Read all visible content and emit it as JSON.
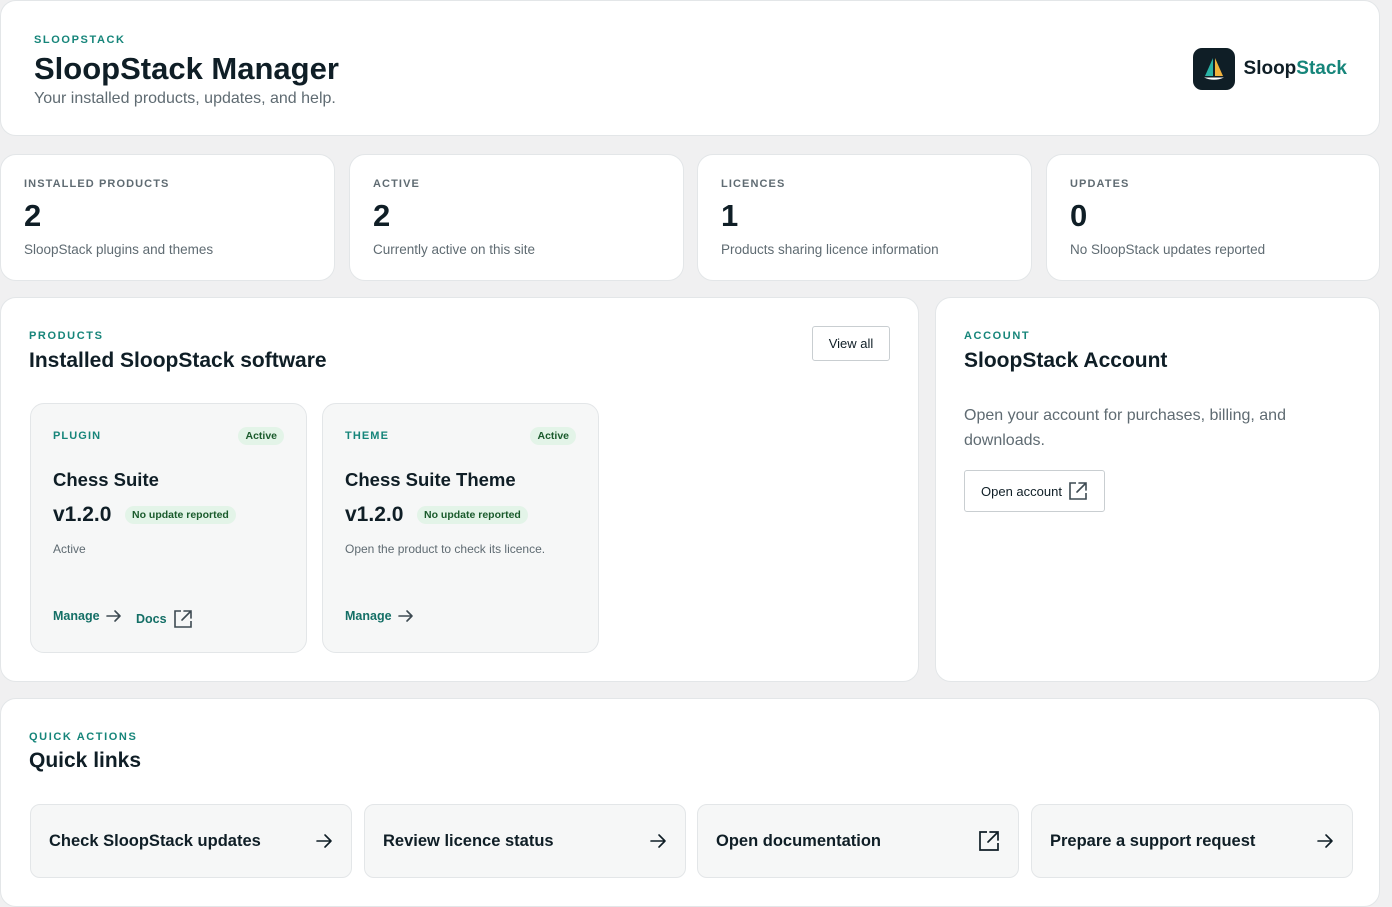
{
  "header": {
    "eyebrow": "SLOOPSTACK",
    "title": "SloopStack Manager",
    "subtitle": "Your installed products, updates, and help.",
    "brand_primary": "Sloop",
    "brand_accent": "Stack",
    "logo_icon": "sailboat-icon"
  },
  "stats": [
    {
      "label": "INSTALLED PRODUCTS",
      "value": "2",
      "description": "SloopStack plugins and themes"
    },
    {
      "label": "ACTIVE",
      "value": "2",
      "description": "Currently active on this site"
    },
    {
      "label": "LICENCES",
      "value": "1",
      "description": "Products sharing licence information"
    },
    {
      "label": "UPDATES",
      "value": "0",
      "description": "No SloopStack updates reported"
    }
  ],
  "products_section": {
    "eyebrow": "PRODUCTS",
    "title": "Installed SloopStack software",
    "view_all_label": "View all",
    "items": [
      {
        "type": "PLUGIN",
        "status": "Active",
        "name": "Chess Suite",
        "version": "v1.2.0",
        "update_status": "No update reported",
        "note": "Active",
        "manage_label": "Manage",
        "docs_label": "Docs"
      },
      {
        "type": "THEME",
        "status": "Active",
        "name": "Chess Suite Theme",
        "version": "v1.2.0",
        "update_status": "No update reported",
        "note": "Open the product to check its licence.",
        "manage_label": "Manage"
      }
    ]
  },
  "account": {
    "eyebrow": "ACCOUNT",
    "title": "SloopStack Account",
    "description": "Open your account for purchases, billing, and downloads.",
    "button_label": "Open account"
  },
  "quick_actions": {
    "eyebrow": "QUICK ACTIONS",
    "title": "Quick links",
    "links": [
      {
        "label": "Check SloopStack updates",
        "icon": "arrow-right-icon"
      },
      {
        "label": "Review licence status",
        "icon": "arrow-right-icon"
      },
      {
        "label": "Open documentation",
        "icon": "external-link-icon"
      },
      {
        "label": "Prepare a support request",
        "icon": "arrow-right-icon"
      }
    ]
  },
  "colors": {
    "accent": "#16857a",
    "text": "#0f1e26",
    "muted": "#5f6b72",
    "page_bg": "#f0f0f1",
    "pill_bg": "#e3f4e8",
    "pill_text": "#1a5b2c"
  }
}
